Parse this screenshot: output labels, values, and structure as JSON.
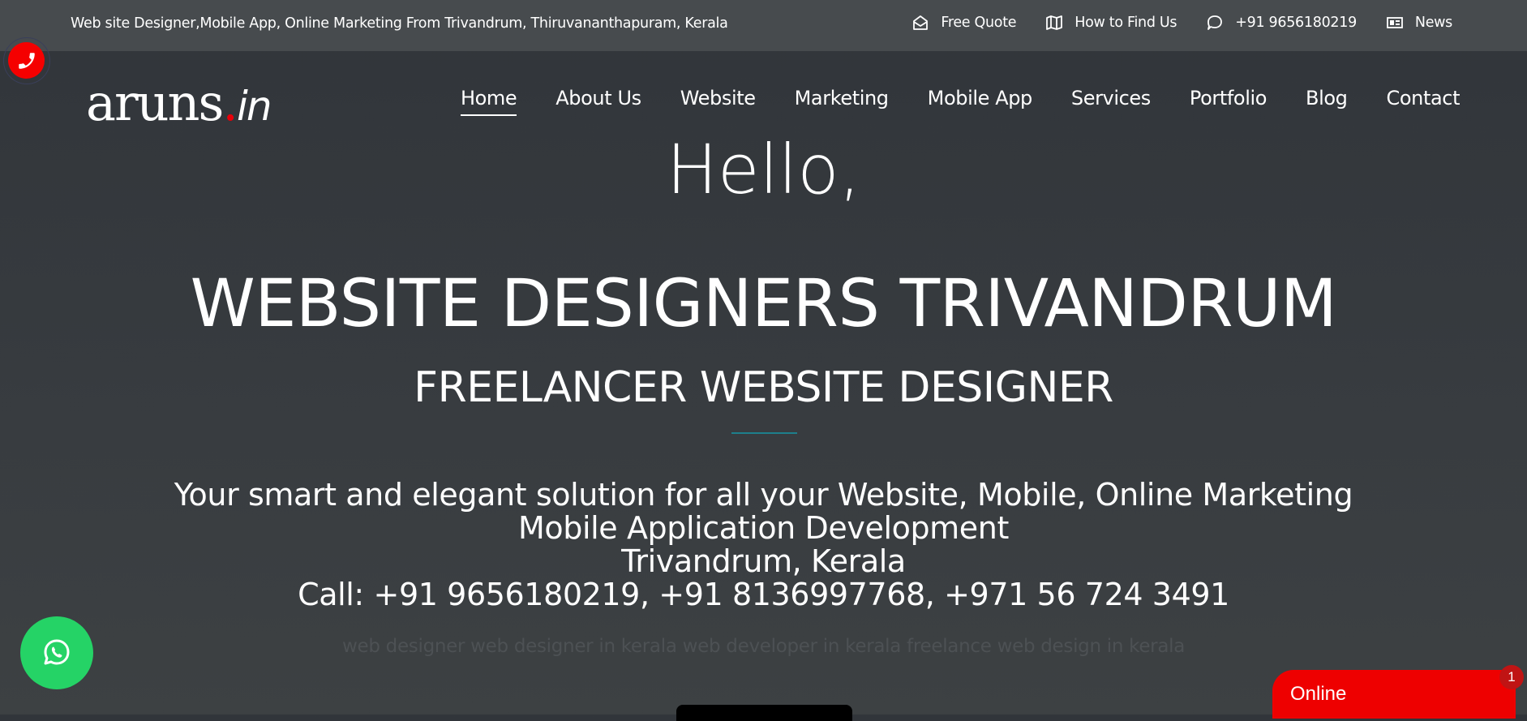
{
  "topbar": {
    "tagline": "Web site Designer,Mobile App, Online Marketing From Trivandrum, Thiruvananthapuram, Kerala",
    "links": [
      {
        "icon": "envelope-open-icon",
        "label": "Free Quote"
      },
      {
        "icon": "map-icon",
        "label": "How to Find Us"
      },
      {
        "icon": "chat-bubble-icon",
        "label": "+91 9656180219"
      },
      {
        "icon": "newspaper-icon",
        "label": "News"
      }
    ]
  },
  "logo": {
    "name": "aruns",
    "dot": ".",
    "tld": "in"
  },
  "nav": {
    "items": [
      {
        "label": "Home",
        "active": true
      },
      {
        "label": "About Us"
      },
      {
        "label": "Website"
      },
      {
        "label": "Marketing"
      },
      {
        "label": "Mobile App"
      },
      {
        "label": "Services"
      },
      {
        "label": "Portfolio"
      },
      {
        "label": "Blog"
      },
      {
        "label": "Contact"
      }
    ]
  },
  "hero": {
    "greeting": "Hello,",
    "title": "WEBSITE DESIGNERS TRIVANDRUM",
    "subtitle": "FREELANCER WEBSITE DESIGNER",
    "lines": [
      "Your smart and elegant solution for all your Website, Mobile, Online Marketing",
      "Mobile Application Development",
      "Trivandrum, Kerala",
      "Call: +91 9656180219, +91 8136997768, +971 56 724 3491"
    ],
    "keywords": "web designer web designer in kerala web developer in kerala freelance web design in kerala"
  },
  "widgets": {
    "online_label": "Online",
    "online_badge": "1"
  },
  "colors": {
    "accent_red": "#f50000",
    "whatsapp_green": "#25d366",
    "divider_teal": "#1d7f8c",
    "topbar_bg": "#474b4e"
  }
}
